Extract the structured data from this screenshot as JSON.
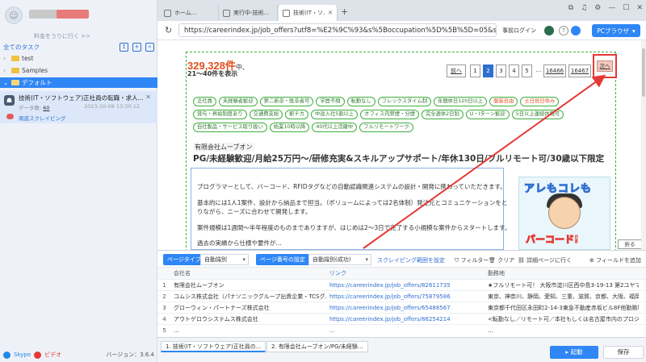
{
  "sidebar": {
    "upgrade_link": "料金をうりに行く >>",
    "all_tasks": "全てのタスク",
    "folders": [
      {
        "label": "test"
      },
      {
        "label": "Samples"
      },
      {
        "label": "デフォルト"
      }
    ],
    "task": {
      "name": "技術(IT・ソフトウェア)正社員の転職・求人...",
      "count_label": "データ数:",
      "count": "60",
      "date": "2023-10-08 13:30:12",
      "cloud": "周遊スクレイピング"
    },
    "footer": {
      "skype": "Skype",
      "video": "ビデオ",
      "version": "バージョン：3.6.4"
    }
  },
  "browser": {
    "tabs": [
      {
        "label": "ホーム..."
      },
      {
        "label": "実行中-技術..."
      },
      {
        "label": "技術(IT・ソ..."
      }
    ],
    "url": "https://careerindex.jp/job_offers?utf8=%E2%9C%93&s%5Boccupation%5D%5B%5D=05&s%...",
    "prelogin": "事前ログイン",
    "pc_browser": "PCブラウザ"
  },
  "page": {
    "result_count": "329,328件",
    "result_suffix": "中、",
    "range": "21～40件を表示",
    "pager": {
      "prev": "前へ",
      "pages": [
        "1",
        "2",
        "3",
        "4",
        "5"
      ],
      "current": "2",
      "ellipsis": "...",
      "last1": "16466",
      "last2": "16467",
      "next": "次へ"
    },
    "tags_row1": [
      "正社員",
      "未経験者歓迎",
      "第二新卒・既卒者可",
      "学歴不問",
      "転勤なし",
      "フレックスタイム制",
      "年間休日120日以上",
      "服装自由",
      "土日祝日休み"
    ],
    "tags_row2": [
      "賞与・昇給制度あり",
      "交通費支給",
      "駅チカ",
      "中途入社5割以上",
      "オフィス内禁煙・分煙",
      "完全週休2日制",
      "U・Iターン歓迎",
      "5日以上連続休暇可"
    ],
    "tags_row3": [
      "自社製品・サービス取り扱い",
      "始業10時以降",
      "40代以上活躍中",
      "フルリモートワーク"
    ],
    "company": "有限会社ムーブオン",
    "job_title": "PG/未経験歓迎/月給25万円～/研修充実&スキルアップサポート/年休130日/フルリモート可/30歳以下限定",
    "desc": [
      "プログラマーとして、バーコード、RFIDタグなどの自動認識関連システムの設計・開発に携わっていただきます。",
      "基本的には1人1案件、設計から納品まで担当。（ボリュームによっては2名体制）発注元とコミュニケーションをと",
      "りながら、ニーズに合わせて開発します。",
      "案件規模は1週間～半年程度のものまでありますが、はじめは2～3日で完了する小規模な案件からスタートします。",
      "過去の実績から仕様や要件が..."
    ],
    "promo_top": "アレもコレも",
    "promo_bottom": "バーコード!",
    "fold": "折る"
  },
  "data_panel": {
    "page_type_label": "ページタイプ",
    "page_type_value": "自動識別",
    "page_num_label": "ページ番号の設定",
    "page_num_value": "自動識別(成功)",
    "scrape_range": "スクレイピング範囲を設定",
    "actions": [
      "フィルター",
      "クリア",
      "詳細ページに行く",
      "フィールドを追加"
    ],
    "columns": [
      "会社名",
      "リンク",
      "勤務地"
    ],
    "rows": [
      {
        "idx": "1",
        "company": "有限会社ムーブオン",
        "link": "https://careerindex.jp/job_offers/82611735",
        "loc": "★フルリモート可！ 大阪市淀川区西中島3-19-13 第2ユヤマビ..."
      },
      {
        "idx": "2",
        "company": "コムシス株式会社（パナソニックグループ出資企業・TCSグ...",
        "link": "https://careerindex.jp/job_offers/75879586",
        "loc": "東京、神奈川、静岡、愛知、三重、滋賀、京都、大阪、福岡いずれ..."
      },
      {
        "idx": "3",
        "company": "グローウィン・パートナーズ株式会社",
        "link": "https://careerindex.jp/job_offers/65488567",
        "loc": "東京都千代田区永田町2-14-3東急不動産赤坂ビル8F他勤務場..."
      },
      {
        "idx": "4",
        "company": "アウトゲロウシステムス株式会社",
        "link": "https://careerindex.jp/job_offers/86254214",
        "loc": "<転勤なし／リモート可／本社もしくは名古屋市内のプロジェク..."
      },
      {
        "idx": "5",
        "company": "...",
        "link": "...",
        "loc": "..."
      }
    ],
    "sheet_tabs": [
      "1. 技術(IT・ソフトウェア)正社員の...",
      "2. 有限会社ムーブオン/PG/未経験..."
    ],
    "start": "起動",
    "save": "保存"
  }
}
